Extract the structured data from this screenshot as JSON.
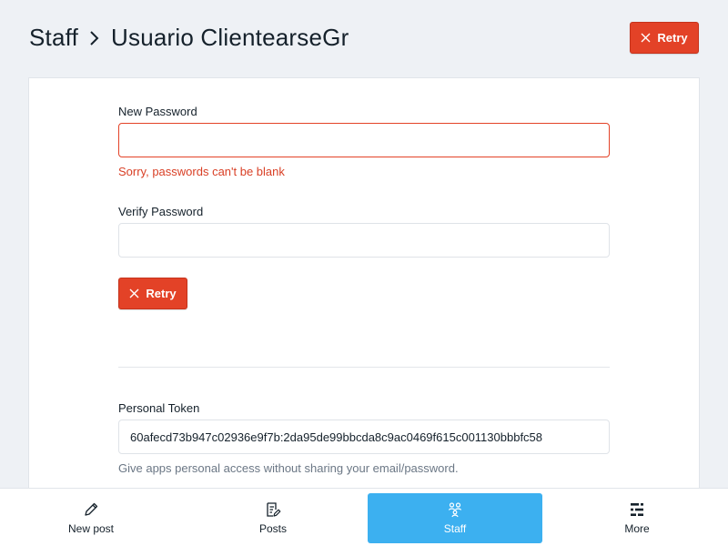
{
  "header": {
    "breadcrumb_parent": "Staff",
    "breadcrumb_current": "Usuario ClientearseGr",
    "retry_label": "Retry"
  },
  "form": {
    "new_password_label": "New Password",
    "new_password_value": "",
    "new_password_error": "Sorry, passwords can't be blank",
    "verify_password_label": "Verify Password",
    "verify_password_value": "",
    "retry_label": "Retry",
    "personal_token_label": "Personal Token",
    "personal_token_value": "60afecd73b947c02936e9f7b:2da95de99bbcda8c9ac0469f615c001130bbbfc58",
    "personal_token_help": "Give apps personal access without sharing your email/password."
  },
  "bottom_nav": {
    "items": [
      {
        "label": "New post",
        "icon": "pencil-icon",
        "active": false
      },
      {
        "label": "Posts",
        "icon": "posts-icon",
        "active": false
      },
      {
        "label": "Staff",
        "icon": "staff-icon",
        "active": true
      },
      {
        "label": "More",
        "icon": "more-icon",
        "active": false
      }
    ]
  },
  "colors": {
    "accent_red": "#e34227",
    "active_nav": "#3cb0f0",
    "background": "#eef1f5"
  }
}
